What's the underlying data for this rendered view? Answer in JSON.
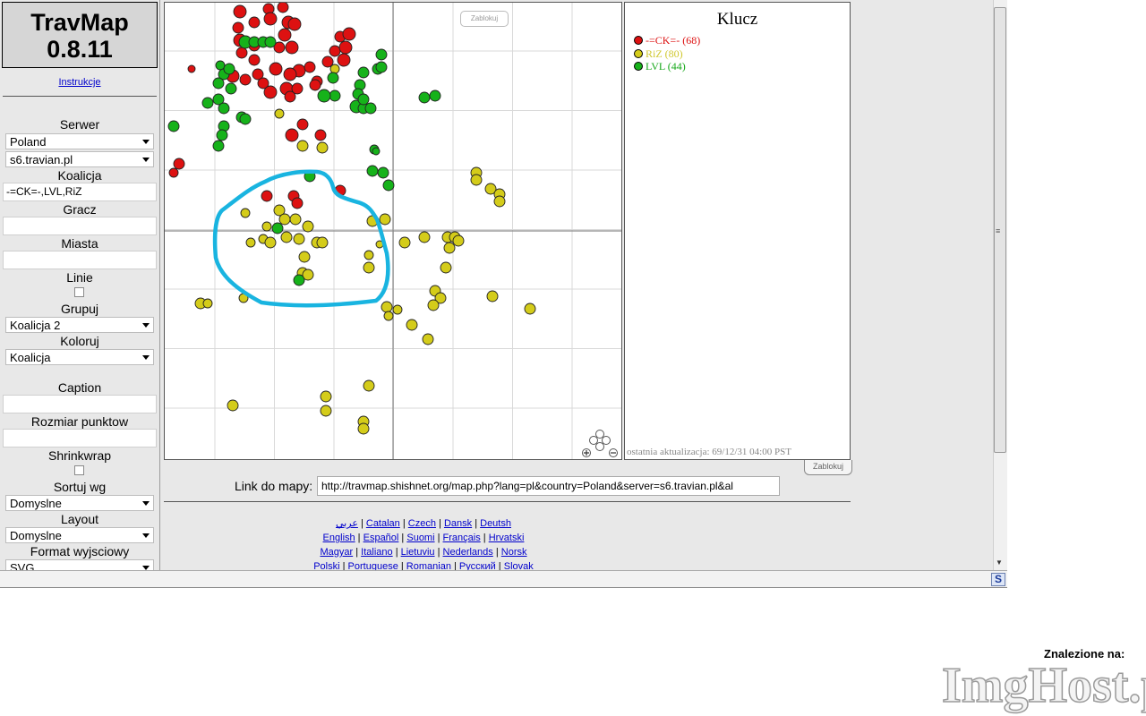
{
  "app": {
    "name": "TravMap",
    "version": "0.8.11",
    "instructions_link": "Instrukcje"
  },
  "sidebar": {
    "serwer_label": "Serwer",
    "country": "Poland",
    "server": "s6.travian.pl",
    "koalicja_label": "Koalicja",
    "koalicja_value": "-=CK=-,LVL,RiZ",
    "gracz_label": "Gracz",
    "gracz_value": "",
    "miasta_label": "Miasta",
    "miasta_value": "",
    "linie_label": "Linie",
    "linie_checked": false,
    "grupuj_label": "Grupuj",
    "grupuj_value": "Koalicja 2",
    "koloruj_label": "Koloruj",
    "koloruj_value": "Koalicja",
    "caption_label": "Caption",
    "caption_value": "",
    "rozmiar_label": "Rozmiar punktow",
    "rozmiar_value": "",
    "shrinkwrap_label": "Shrinkwrap",
    "shrinkwrap_checked": false,
    "sortuj_label": "Sortuj wg",
    "sortuj_value": "Domyslne",
    "layout_label": "Layout",
    "layout_value": "Domyslne",
    "format_label": "Format wyjsciowy",
    "format_value": "SVG"
  },
  "map": {
    "lock_button": "Zablokuj",
    "colors": {
      "red": "#dd1111",
      "yellow": "#d4cc1a",
      "green": "#16b21a",
      "highlight": "#19b4e0",
      "grid": "#d9d9d9",
      "axis": "#8a8a8a"
    },
    "icons": [
      "zoom-in-icon",
      "zoom-out-icon",
      "pan-control-icon"
    ]
  },
  "key": {
    "title": "Klucz",
    "items": [
      {
        "label": "-=CK=- (68)",
        "color": "#dd1111",
        "text_color": "#dd1111"
      },
      {
        "label": "RiZ (80)",
        "color": "#d4cc1a",
        "text_color": "#d0c830"
      },
      {
        "label": "LVL (44)",
        "color": "#16b21a",
        "text_color": "#16a81a"
      }
    ],
    "updated": "ostatnia aktualizacja: 69/12/31 04:00 PST",
    "lock_button": "Zablokuj"
  },
  "link": {
    "label": "Link do mapy:",
    "url": "http://travmap.shishnet.org/map.php?lang=pl&country=Poland&server=s6.travian.pl&al"
  },
  "languages": [
    [
      "عربي",
      "Catalan",
      "Czech",
      "Dansk",
      "Deutsh"
    ],
    [
      "English",
      "Español",
      "Suomi",
      "Français",
      "Hrvatski"
    ],
    [
      "Magyar",
      "Italiano",
      "Lietuviu",
      "Nederlands",
      "Norsk"
    ],
    [
      "Polski",
      "Portuguese",
      "Romanian",
      "Русский",
      "Slovak"
    ]
  ],
  "watermark": {
    "found_on": "Znalezione na:",
    "brand": "ImgHost.pl"
  }
}
